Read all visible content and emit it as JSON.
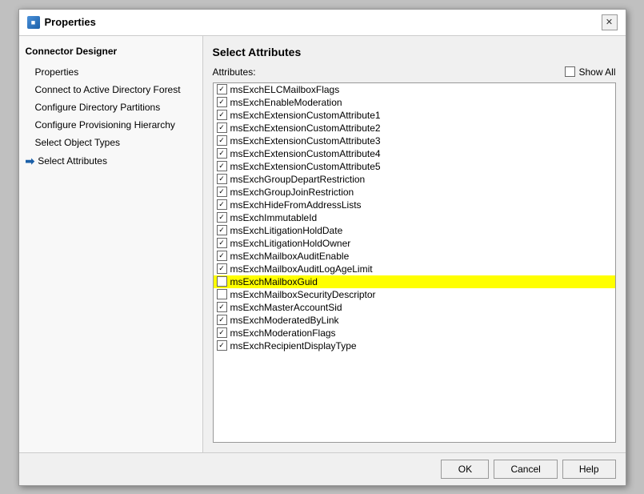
{
  "dialog": {
    "title": "Properties",
    "close_label": "✕"
  },
  "sidebar": {
    "title": "Connector Designer",
    "items": [
      {
        "label": "Properties",
        "arrow": false,
        "indent": true
      },
      {
        "label": "Connect to Active Directory Forest",
        "arrow": false,
        "indent": true
      },
      {
        "label": "Configure Directory Partitions",
        "arrow": false,
        "indent": true
      },
      {
        "label": "Configure Provisioning Hierarchy",
        "arrow": false,
        "indent": true
      },
      {
        "label": "Select Object Types",
        "arrow": false,
        "indent": true
      },
      {
        "label": "Select Attributes",
        "arrow": true,
        "indent": false
      }
    ]
  },
  "main": {
    "panel_title": "Select Attributes",
    "attributes_label": "Attributes:",
    "show_all_label": "Show All",
    "show_all_checked": false,
    "attributes": [
      {
        "label": "msExchELCMailboxFlags",
        "checked": true,
        "highlighted": false
      },
      {
        "label": "msExchEnableModeration",
        "checked": true,
        "highlighted": false
      },
      {
        "label": "msExchExtensionCustomAttribute1",
        "checked": true,
        "highlighted": false
      },
      {
        "label": "msExchExtensionCustomAttribute2",
        "checked": true,
        "highlighted": false
      },
      {
        "label": "msExchExtensionCustomAttribute3",
        "checked": true,
        "highlighted": false
      },
      {
        "label": "msExchExtensionCustomAttribute4",
        "checked": true,
        "highlighted": false
      },
      {
        "label": "msExchExtensionCustomAttribute5",
        "checked": true,
        "highlighted": false
      },
      {
        "label": "msExchGroupDepartRestriction",
        "checked": true,
        "highlighted": false
      },
      {
        "label": "msExchGroupJoinRestriction",
        "checked": true,
        "highlighted": false
      },
      {
        "label": "msExchHideFromAddressLists",
        "checked": true,
        "highlighted": false
      },
      {
        "label": "msExchImmutableId",
        "checked": true,
        "highlighted": false
      },
      {
        "label": "msExchLitigationHoldDate",
        "checked": true,
        "highlighted": false
      },
      {
        "label": "msExchLitigationHoldOwner",
        "checked": true,
        "highlighted": false
      },
      {
        "label": "msExchMailboxAuditEnable",
        "checked": true,
        "highlighted": false
      },
      {
        "label": "msExchMailboxAuditLogAgeLimit",
        "checked": true,
        "highlighted": false
      },
      {
        "label": "msExchMailboxGuid",
        "checked": false,
        "highlighted": true
      },
      {
        "label": "msExchMailboxSecurityDescriptor",
        "checked": false,
        "highlighted": false
      },
      {
        "label": "msExchMasterAccountSid",
        "checked": true,
        "highlighted": false
      },
      {
        "label": "msExchModeratedByLink",
        "checked": true,
        "highlighted": false
      },
      {
        "label": "msExchModerationFlags",
        "checked": true,
        "highlighted": false
      },
      {
        "label": "msExchRecipientDisplayType",
        "checked": true,
        "highlighted": false
      }
    ]
  },
  "footer": {
    "ok_label": "OK",
    "cancel_label": "Cancel",
    "help_label": "Help"
  }
}
